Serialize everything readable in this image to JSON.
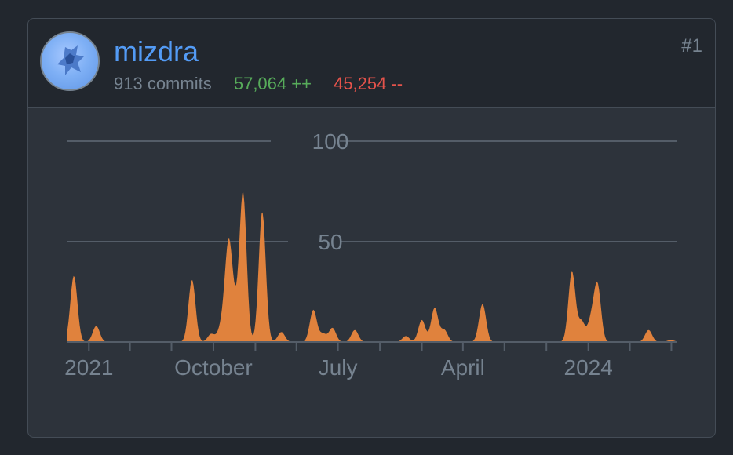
{
  "contributor": {
    "username": "mizdra",
    "rank": "#1",
    "commits": "913 commits",
    "additions": "57,064 ++",
    "deletions": "45,254 --"
  },
  "colors": {
    "area": "#e0823d",
    "link": "#539bf5",
    "additions": "#57ab5a",
    "deletions": "#e5534b",
    "grid": "#545d68",
    "text_muted": "#768390"
  },
  "icons": [
    "avatar-image"
  ],
  "chart_data": {
    "type": "area",
    "x_unit": "week",
    "x_start": "2020-11-15",
    "x_end": "2024-07-14",
    "ylim": [
      0,
      100
    ],
    "y_ticks": [
      50,
      100
    ],
    "x_ticks": [
      {
        "label": "2021",
        "date": "2021-01-01"
      },
      {
        "label": "October",
        "date": "2021-10-01"
      },
      {
        "label": "July",
        "date": "2022-07-01"
      },
      {
        "label": "April",
        "date": "2023-04-01"
      },
      {
        "label": "2024",
        "date": "2024-01-01"
      }
    ],
    "grid": true,
    "series": [
      {
        "color": "#e0823d",
        "peaks": [
          {
            "date": "2020-11-29",
            "value": 33
          },
          {
            "date": "2021-01-17",
            "value": 8
          },
          {
            "date": "2021-08-15",
            "value": 31
          },
          {
            "date": "2021-09-26",
            "value": 4
          },
          {
            "date": "2021-10-17",
            "value": 6
          },
          {
            "date": "2021-10-31",
            "value": 27
          },
          {
            "date": "2021-11-07",
            "value": 29
          },
          {
            "date": "2021-11-21",
            "value": 10
          },
          {
            "date": "2021-12-05",
            "value": 73
          },
          {
            "date": "2022-01-16",
            "value": 65
          },
          {
            "date": "2022-02-27",
            "value": 5
          },
          {
            "date": "2022-05-08",
            "value": 16
          },
          {
            "date": "2022-05-29",
            "value": 4
          },
          {
            "date": "2022-06-19",
            "value": 7
          },
          {
            "date": "2022-08-07",
            "value": 6
          },
          {
            "date": "2022-11-27",
            "value": 3
          },
          {
            "date": "2023-01-01",
            "value": 11
          },
          {
            "date": "2023-01-29",
            "value": 17
          },
          {
            "date": "2023-02-19",
            "value": 6
          },
          {
            "date": "2023-05-14",
            "value": 19
          },
          {
            "date": "2023-11-26",
            "value": 35
          },
          {
            "date": "2023-12-17",
            "value": 10
          },
          {
            "date": "2024-01-07",
            "value": 10
          },
          {
            "date": "2024-01-21",
            "value": 28
          },
          {
            "date": "2024-05-12",
            "value": 6
          },
          {
            "date": "2024-06-30",
            "value": 1
          }
        ]
      }
    ]
  }
}
